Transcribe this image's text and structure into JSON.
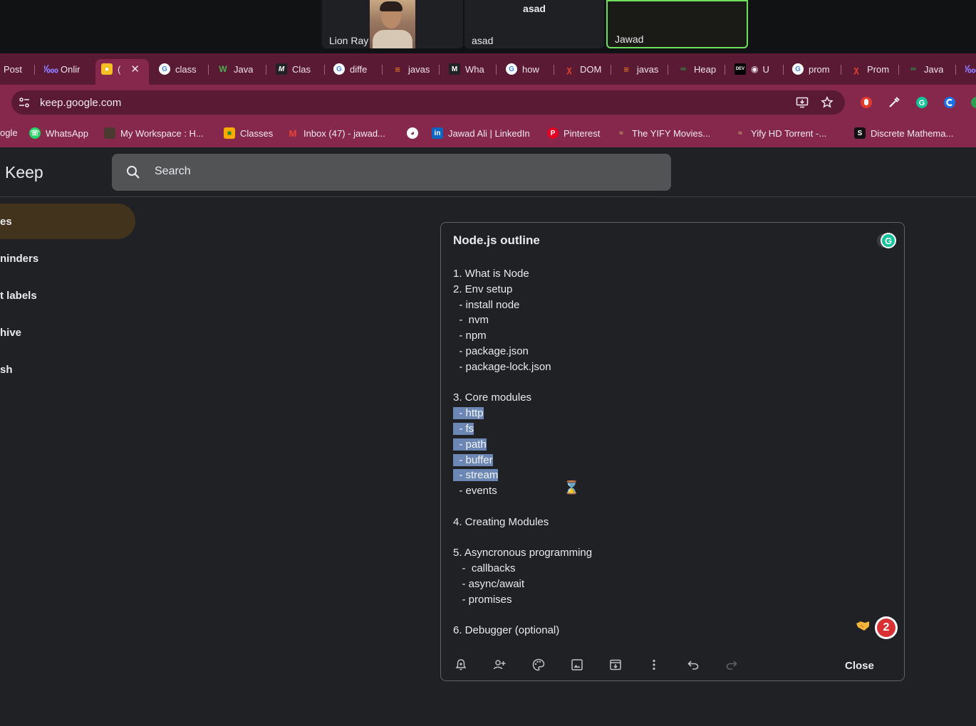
{
  "call": {
    "tiles": [
      {
        "name": "Lion Ray"
      },
      {
        "name": "asad",
        "top_label": "asad"
      },
      {
        "name": "Jawad"
      }
    ]
  },
  "tabs": [
    {
      "label": "Post",
      "icon": "post-favicon"
    },
    {
      "label": "Onlir",
      "icon": "online-favicon"
    },
    {
      "label": "(",
      "icon": "keep-favicon",
      "active": true
    },
    {
      "label": "class",
      "icon": "google-favicon"
    },
    {
      "label": "Java",
      "icon": "w3schools-favicon"
    },
    {
      "label": "Clas",
      "icon": "medium-favicon"
    },
    {
      "label": "diffe",
      "icon": "google-favicon"
    },
    {
      "label": "javas",
      "icon": "stackoverflow-favicon"
    },
    {
      "label": "Wha",
      "icon": "medium-favicon"
    },
    {
      "label": "how",
      "icon": "google-favicon"
    },
    {
      "label": "DOM",
      "icon": "dom-favicon"
    },
    {
      "label": "javas",
      "icon": "stackoverflow-favicon"
    },
    {
      "label": "Heap",
      "icon": "geeks-favicon"
    },
    {
      "label": "U",
      "icon": "dev-favicon"
    },
    {
      "label": "prom",
      "icon": "google-favicon"
    },
    {
      "label": "Prom",
      "icon": "dom-favicon"
    },
    {
      "label": "Java",
      "icon": "geeks-favicon"
    }
  ],
  "address": {
    "url": "keep.google.com"
  },
  "bookmarks": [
    {
      "label": "ogle",
      "icon": "google-bookmark-icon"
    },
    {
      "label": "WhatsApp",
      "icon": "whatsapp-icon"
    },
    {
      "label": "My Workspace : H...",
      "icon": "workspace-icon"
    },
    {
      "label": "Classes",
      "icon": "classroom-icon"
    },
    {
      "label": "Inbox (47) - jawad...",
      "icon": "gmail-icon"
    },
    {
      "label": "",
      "icon": "globe-icon"
    },
    {
      "label": "Jawad Ali | LinkedIn",
      "icon": "linkedin-icon"
    },
    {
      "label": "Pinterest",
      "icon": "pinterest-icon"
    },
    {
      "label": "The YIFY Movies...",
      "icon": "yify-icon"
    },
    {
      "label": "Yify HD Torrent -...",
      "icon": "yify-icon"
    },
    {
      "label": "Discrete Mathema...",
      "icon": "s-icon"
    }
  ],
  "keep": {
    "title": "Keep",
    "search_placeholder": "Search",
    "nav": [
      "es",
      "ninders",
      "t labels",
      "hive",
      "sh"
    ]
  },
  "note": {
    "title": "Node.js outline",
    "lines": [
      {
        "text": "1. What is Node",
        "selected": false
      },
      {
        "text": "2. Env setup",
        "selected": false
      },
      {
        "text": "  - install node",
        "selected": false
      },
      {
        "text": "  -  nvm",
        "selected": false
      },
      {
        "text": "  - npm",
        "selected": false
      },
      {
        "text": "  - package.json",
        "selected": false
      },
      {
        "text": "  - package-lock.json",
        "selected": false
      },
      {
        "text": "",
        "selected": false
      },
      {
        "text": "3. Core modules",
        "selected": false
      },
      {
        "text": "  - http",
        "selected": true
      },
      {
        "text": "  - fs",
        "selected": true
      },
      {
        "text": "  - path",
        "selected": true
      },
      {
        "text": "  - buffer",
        "selected": true
      },
      {
        "text": "  - stream",
        "selected": true
      },
      {
        "text": "  - events",
        "selected": false
      },
      {
        "text": "",
        "selected": false
      },
      {
        "text": "4. Creating Modules",
        "selected": false
      },
      {
        "text": "",
        "selected": false
      },
      {
        "text": "5. Asyncronous programming",
        "selected": false
      },
      {
        "text": "   -  callbacks",
        "selected": false
      },
      {
        "text": "   - async/await",
        "selected": false
      },
      {
        "text": "   - promises",
        "selected": false
      },
      {
        "text": "",
        "selected": false
      },
      {
        "text": "6. Debugger (optional)",
        "selected": false
      }
    ],
    "badge_count": "2",
    "close_label": "Close"
  },
  "colors": {
    "tab_strip": "#5b1a34",
    "toolbar": "#86284c",
    "page_bg": "#202124",
    "selection": "#6d87b4"
  }
}
